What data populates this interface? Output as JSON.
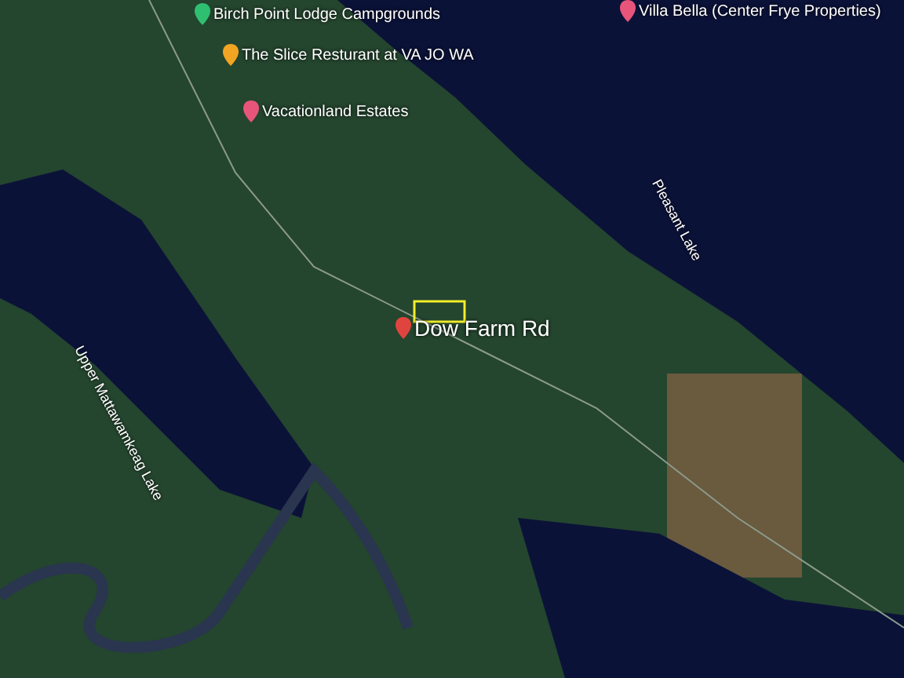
{
  "places": [
    {
      "label": "Birch Point Lodge Campgrounds",
      "color": "#2fbf71"
    },
    {
      "label": "Villa Bella (Center Frye Properties)",
      "color": "#e8557a"
    },
    {
      "label": "The Slice Resturant at VA JO WA",
      "color": "#f2a522"
    },
    {
      "label": "Vacationland Estates",
      "color": "#e8557a"
    }
  ],
  "lakes": [
    {
      "label": "Pleasant Lake"
    },
    {
      "label": "Upper Mattawamkeag Lake"
    }
  ],
  "marker": {
    "label": "Dow Farm Rd",
    "color": "#e0443e"
  }
}
